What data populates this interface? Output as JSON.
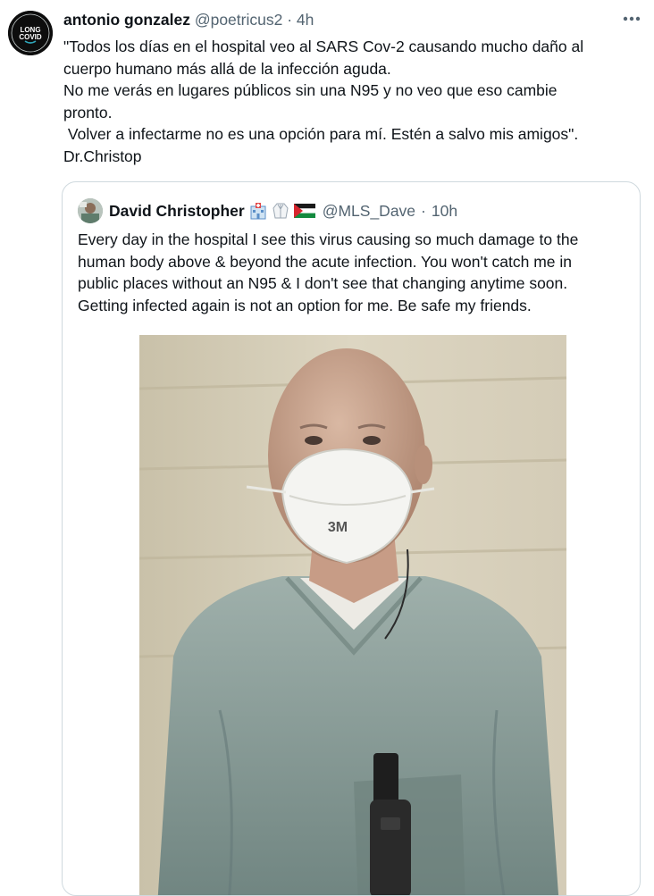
{
  "tweet": {
    "author": {
      "name": "antonio gonzalez",
      "handle": "@poetricus2",
      "time": "4h",
      "avatar_text": [
        "LONG",
        "COVID"
      ]
    },
    "more_icon": "more-dots-icon",
    "text": "\"Todos los días en el hospital veo al SARS Cov-2 causando mucho daño al\ncuerpo humano más allá de la infección aguda.\nNo me verás en lugares públicos sin una N95 y no veo que eso cambie\npronto.\n Volver a infectarme no es una opción para mí. Estén a salvo mis amigos\".\nDr.Christop"
  },
  "quoted_tweet": {
    "author": {
      "name": "David Christopher",
      "handle": "@MLS_Dave",
      "time": "10h",
      "emojis": [
        "hospital-emoji",
        "lab-coat-emoji",
        "palestine-flag-emoji"
      ]
    },
    "text": "Every day in the hospital I see this virus causing so much damage to the\nhuman body above & beyond the acute infection. You won't catch me in\npublic places without an N95 & I don't see that changing anytime soon.\nGetting infected again is not an option for me. Be safe my friends.",
    "photo": {
      "mask_label": "3M"
    }
  },
  "colors": {
    "text": "#0f1419",
    "secondary": "#536471",
    "border": "#cfd9de"
  }
}
